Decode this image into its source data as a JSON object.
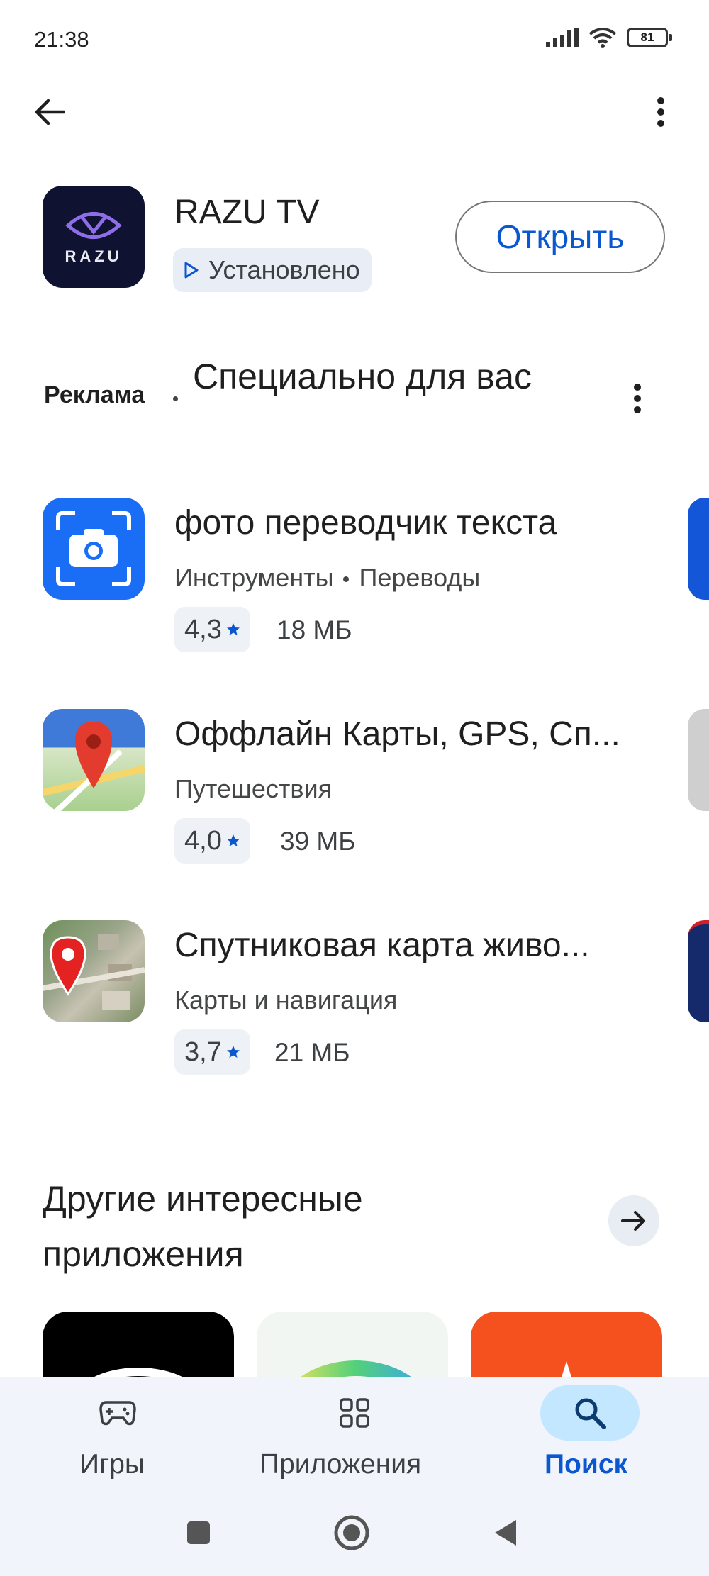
{
  "status_bar": {
    "time": "21:38",
    "battery": "81"
  },
  "top_bar": {
    "back_icon": "arrow-back-icon",
    "more_icon": "more-vert-icon"
  },
  "installed_app": {
    "name": "RAZU TV",
    "logo_text": "RAZU",
    "status": "Установлено",
    "open_button": "Открыть"
  },
  "ad_section": {
    "label": "Реклама",
    "title": "Специально для вас"
  },
  "apps": [
    {
      "title": "фото переводчик текста",
      "categories": [
        "Инструменты",
        "Переводы"
      ],
      "rating": "4,3",
      "size": "18 МБ"
    },
    {
      "title": "Оффлайн Карты, GPS, Сп...",
      "categories": [
        "Путешествия"
      ],
      "rating": "4,0",
      "size": "39 МБ"
    },
    {
      "title": "Спутниковая карта живо...",
      "categories": [
        "Карты и навигация"
      ],
      "rating": "3,7",
      "size": "21 МБ"
    }
  ],
  "other_section": {
    "title": "Другие интересные приложения"
  },
  "bottom_nav": {
    "items": [
      {
        "label": "Игры",
        "icon": "gamepad-icon"
      },
      {
        "label": "Приложения",
        "icon": "apps-grid-icon"
      },
      {
        "label": "Поиск",
        "icon": "search-icon",
        "active": true
      }
    ]
  },
  "colors": {
    "accent": "#0b57d0",
    "nav_bg": "#f1f4fa",
    "chip_bg": "#e9eef6"
  }
}
